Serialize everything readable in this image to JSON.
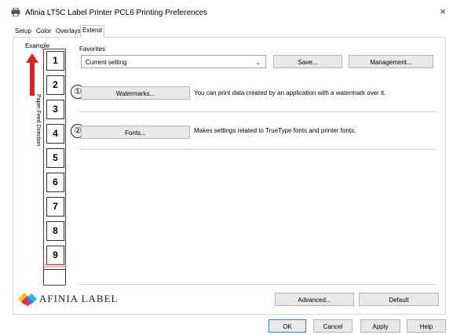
{
  "window": {
    "title": "Afinia LT5C Label Printer PCL6 Printing Preferences",
    "close_glyph": "×",
    "printer_icon": "printer-icon"
  },
  "tabs": [
    {
      "label": "Setup"
    },
    {
      "label": "Color"
    },
    {
      "label": "Overlays"
    },
    {
      "label": "Extend",
      "active": true
    }
  ],
  "example": {
    "label": "Example",
    "feed_direction_label": "Paper Feed Direction",
    "cells": [
      "1",
      "2",
      "3",
      "4",
      "5",
      "6",
      "7",
      "8",
      "9"
    ],
    "accent_color": "#e02020"
  },
  "favorites": {
    "label": "Favorites",
    "selected": "Current setting",
    "save_label": "Save...",
    "management_label": "Management..."
  },
  "watermarks": {
    "marker": "①",
    "button_label": "Watermarks...",
    "description": "You can print data created by an application with a watermark over it."
  },
  "fonts": {
    "marker": "②",
    "button_label": "Fonts...",
    "description": "Makes settings related to TrueType fonts and printer fonts."
  },
  "logo": {
    "text": "AFINIA LABEL",
    "colors": [
      "#f5c400",
      "#e6007e",
      "#00a0e9",
      "#231f20"
    ]
  },
  "panel_buttons": {
    "advanced_label": "Advanced...",
    "default_label": "Default"
  },
  "dialog_buttons": {
    "ok_label": "OK",
    "cancel_label": "Cancel",
    "apply_label": "Apply",
    "help_label": "Help"
  }
}
